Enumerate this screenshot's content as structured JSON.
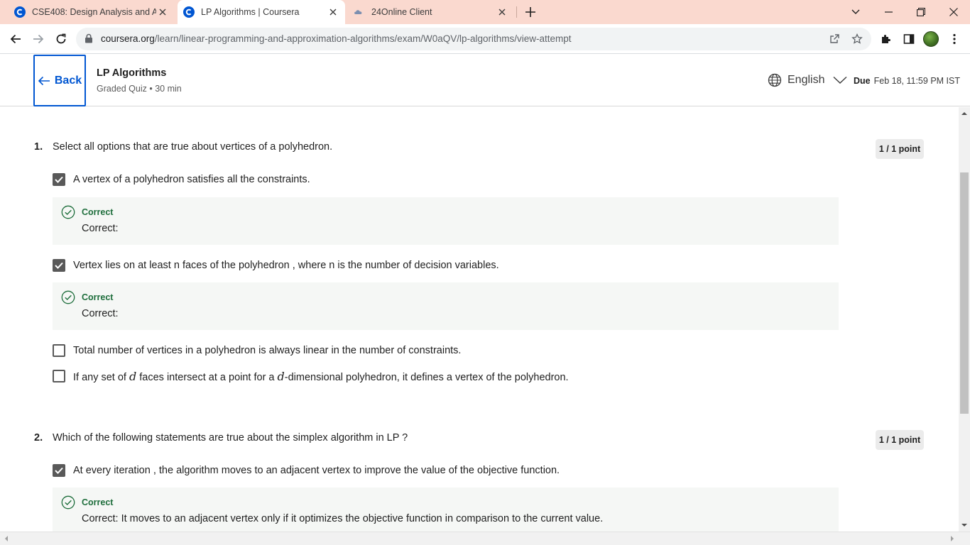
{
  "browser": {
    "tabs": [
      {
        "title": "CSE408: Design Analysis and Alg",
        "active": false,
        "favicon": "coursera-icon"
      },
      {
        "title": "LP Algorithms | Coursera",
        "active": true,
        "favicon": "coursera-icon"
      },
      {
        "title": "24Online Client",
        "active": false,
        "favicon": "cloud-icon"
      }
    ],
    "url_host": "coursera.org",
    "url_path": "/learn/linear-programming-and-approximation-algorithms/exam/W0aQV/lp-algorithms/view-attempt"
  },
  "header": {
    "back_label": "Back",
    "title": "LP Algorithms",
    "meta": "Graded Quiz • 30 min",
    "language": "English",
    "due_label": "Due",
    "due_value": "Feb 18, 11:59 PM IST"
  },
  "questions": [
    {
      "number": "1.",
      "text": "Select all options that are true about vertices of a polyhedron.",
      "points": "1 / 1 point",
      "options": [
        {
          "pre": "A vertex of a polyhedron satisfies all the constraints.",
          "checked": true
        },
        {
          "pre": "Vertex lies on at least n faces of the polyhedron , where n is the number of decision variables.",
          "checked": true
        },
        {
          "pre": "Total number of vertices in a polyhedron is always linear in the  number of constraints.",
          "checked": false
        },
        {
          "pre": "If any set of ",
          "var1": "d",
          "mid": " faces intersect at a point for a ",
          "var2": "d",
          "post": "-dimensional polyhedron, it defines a vertex of the polyhedron.",
          "checked": false
        }
      ],
      "feedback": [
        {
          "title": "Correct",
          "text": "Correct:"
        },
        {
          "title": "Correct",
          "text": "Correct:"
        }
      ]
    },
    {
      "number": "2.",
      "text": "Which of the following statements are true about the simplex algorithm in LP ?",
      "points": "1 / 1 point",
      "options": [
        {
          "pre": "At every iteration , the algorithm moves to an adjacent vertex to improve the value of the objective function.",
          "checked": true
        }
      ],
      "feedback": [
        {
          "title": "Correct",
          "text": "Correct: It moves to an adjacent vertex only if it optimizes the objective function in comparison to the current value."
        }
      ]
    }
  ],
  "colors": {
    "accent": "#0056d2",
    "correct": "#1e6e3c",
    "tabbar": "#fad9cf"
  }
}
